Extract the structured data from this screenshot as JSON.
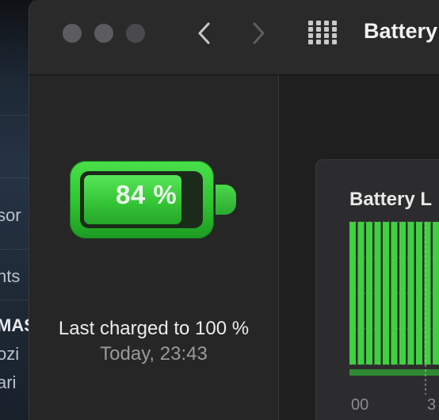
{
  "background_app": {
    "snippets": [
      "sor",
      "nts",
      "MAS",
      "ozi",
      "ari"
    ]
  },
  "window": {
    "title": "Battery",
    "traffic_lights": [
      "close",
      "minimize",
      "zoom"
    ],
    "nav": {
      "back_icon": "chevron-left-icon",
      "forward_icon": "chevron-right-icon",
      "grid_icon": "grid-icon"
    }
  },
  "battery": {
    "percent": 84,
    "label": "84 %",
    "last_charged": "Last charged to 100 %",
    "last_charged_time": "Today, 23:43",
    "color": "#34c335"
  },
  "chart_card": {
    "title": "Battery L",
    "x_tick_labels": [
      "00",
      "3"
    ]
  },
  "chart_data": {
    "type": "bar",
    "title": "Battery L",
    "xlabel": "",
    "ylabel": "",
    "series": [
      {
        "values": [
          100,
          100,
          100,
          100,
          100,
          100,
          100,
          100,
          100,
          100,
          100,
          100,
          100,
          100,
          100,
          100
        ]
      }
    ],
    "ylim": [
      0,
      100
    ],
    "grid": true,
    "bar_color": "#3fd13f"
  }
}
